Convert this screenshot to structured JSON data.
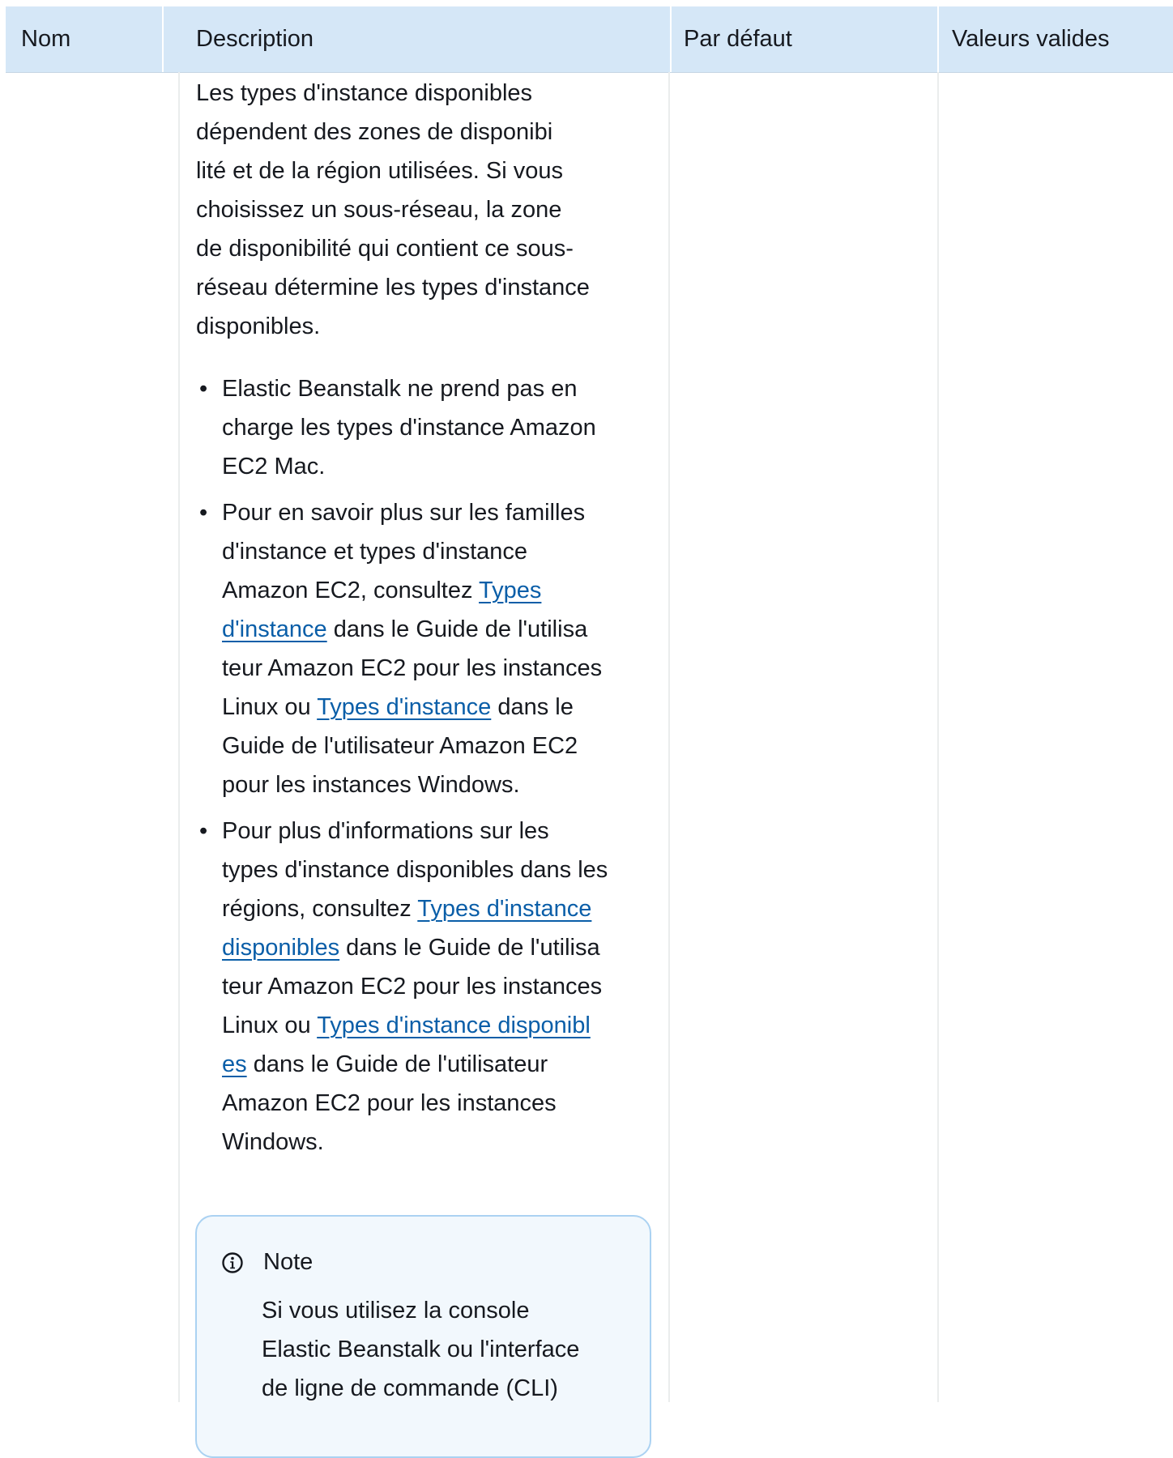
{
  "table": {
    "headers": [
      "Nom",
      "Description",
      "Par défaut",
      "Valeurs valides"
    ]
  },
  "description": {
    "paragraph_lines": [
      "Les types d'instance disponibles",
      "dépendent des zones de disponibi",
      "lité et de la région utilisées. Si vous",
      "choisissez un sous-réseau, la zone",
      "de disponibilité qui contient ce sous-",
      "réseau détermine les types d'instance",
      "disponibles."
    ],
    "bullet1": [
      "Elastic Beanstalk ne prend pas en",
      "charge les types d'instance Amazon",
      "EC2 Mac."
    ],
    "bullet2": {
      "l1": "Pour en savoir plus sur les familles",
      "l2": "d'instance et types d'instance",
      "l3_text": "Amazon EC2, consultez ",
      "link1_part1": "Types",
      "link1_part2": "d'instance",
      "l4_text": " dans le Guide de l'utilisa",
      "l5": "teur Amazon EC2 pour les instances",
      "l6_text": "Linux ou ",
      "link2": "Types d'instance",
      "l6_after": " dans le",
      "l7": "Guide de l'utilisateur Amazon EC2",
      "l8": "pour les instances Windows."
    },
    "bullet3": {
      "l1": "Pour plus d'informations sur les",
      "l2": "types d'instance disponibles dans les",
      "l3_text": "régions, consultez ",
      "link1_part1": "Types d'instance",
      "link1_part2": "disponibles",
      "l4_text": " dans le Guide de l'utilisa",
      "l5": "teur Amazon EC2 pour les instances",
      "l6_text": "Linux ou ",
      "link2_part1": "Types d'instance disponibl",
      "link2_part2": "es",
      "l7_text": " dans le Guide de l'utilisateur",
      "l8": "Amazon EC2 pour les instances",
      "l9": "Windows."
    }
  },
  "note": {
    "icon": "info-icon",
    "title": "Note",
    "body_lines": [
      "Si vous utilisez la console",
      "Elastic Beanstalk ou l'interface",
      "de ligne de commande (CLI)"
    ]
  },
  "colors": {
    "header_bg": "#d5e7f7",
    "link": "#0a5ea8",
    "note_bg": "#f2f8fd",
    "note_border": "#abd2f2"
  }
}
